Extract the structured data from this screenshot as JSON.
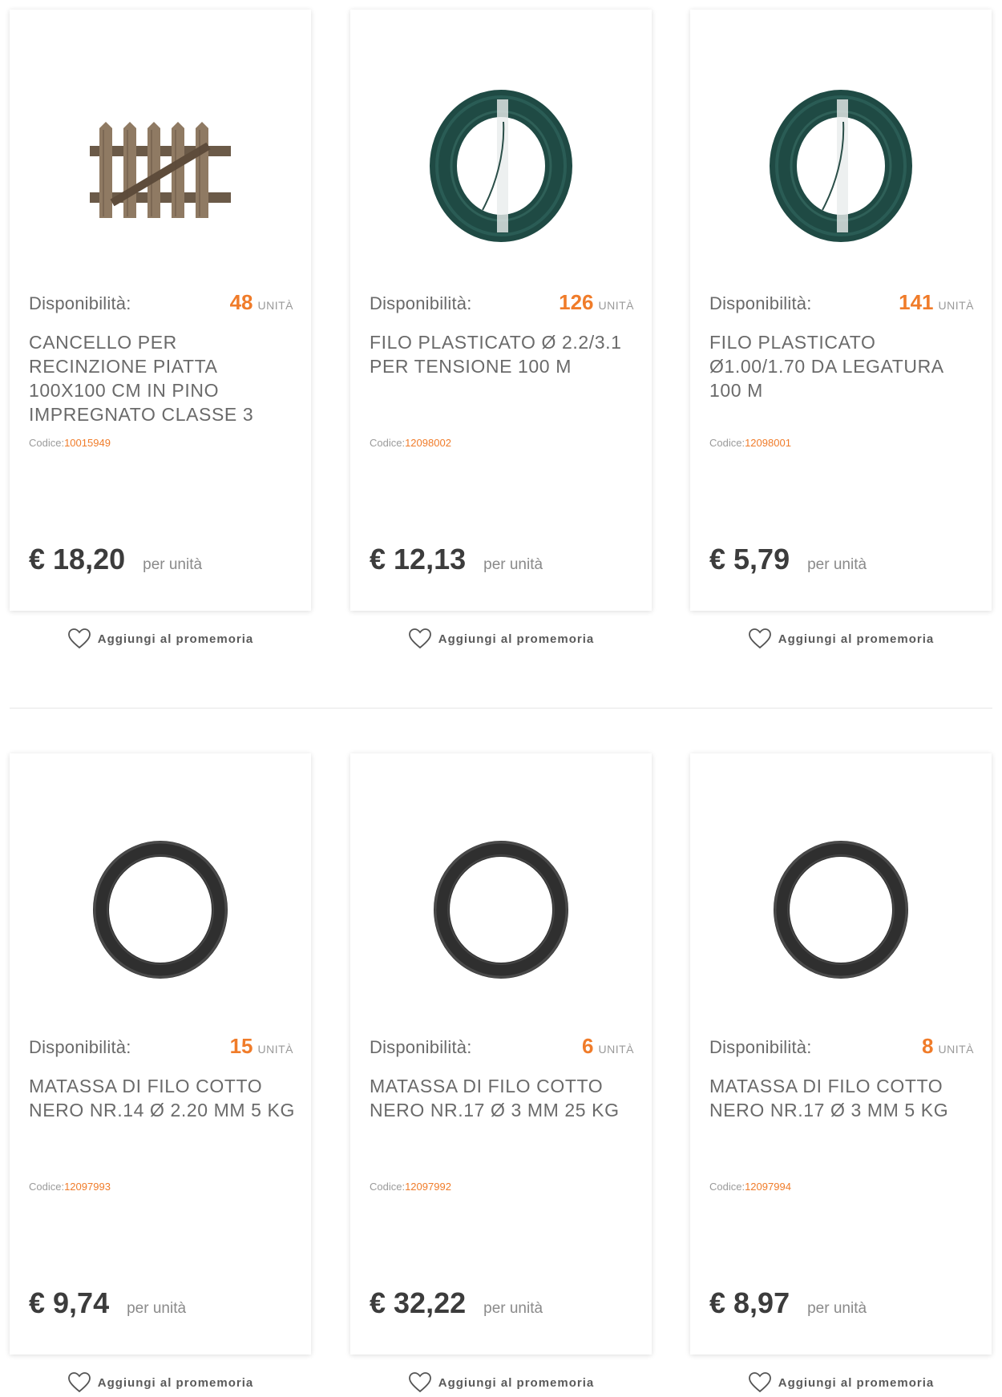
{
  "products": [
    {
      "image": "wooden-gate-image",
      "availability_label": "Disponibilità:",
      "quantity": "48",
      "unit": "UNITÀ",
      "title": "CANCELLO PER RECINZIONE PIATTA 100X100 CM IN PINO IMPREGNATO CLASSE 3",
      "code_label": "Codice:",
      "code": "10015949",
      "price": "€ 18,20",
      "per_unit": "per unità",
      "reminder_label": "Aggiungi al promemoria"
    },
    {
      "image": "green-wire-coil-image",
      "availability_label": "Disponibilità:",
      "quantity": "126",
      "unit": "UNITÀ",
      "title": "FILO PLASTICATO Ø 2.2/3.1 PER TENSIONE 100 M",
      "code_label": "Codice:",
      "code": "12098002",
      "price": "€ 12,13",
      "per_unit": "per unità",
      "reminder_label": "Aggiungi al promemoria"
    },
    {
      "image": "green-wire-coil-image",
      "availability_label": "Disponibilità:",
      "quantity": "141",
      "unit": "UNITÀ",
      "title": "FILO PLASTICATO Ø1.00/1.70 DA LEGATURA 100 M",
      "code_label": "Codice:",
      "code": "12098001",
      "price": "€ 5,79",
      "per_unit": "per unità",
      "reminder_label": "Aggiungi al promemoria"
    },
    {
      "image": "black-wire-coil-image",
      "availability_label": "Disponibilità:",
      "quantity": "15",
      "unit": "UNITÀ",
      "title": "MATASSA DI FILO COTTO NERO NR.14 Ø 2.20 MM 5 KG",
      "code_label": "Codice:",
      "code": "12097993",
      "price": "€ 9,74",
      "per_unit": "per unità",
      "reminder_label": "Aggiungi al promemoria"
    },
    {
      "image": "black-wire-coil-image",
      "availability_label": "Disponibilità:",
      "quantity": "6",
      "unit": "UNITÀ",
      "title": "MATASSA DI FILO COTTO NERO NR.17 Ø 3 MM 25 KG",
      "code_label": "Codice:",
      "code": "12097992",
      "price": "€ 32,22",
      "per_unit": "per unità",
      "reminder_label": "Aggiungi al promemoria"
    },
    {
      "image": "black-wire-coil-image",
      "availability_label": "Disponibilità:",
      "quantity": "8",
      "unit": "UNITÀ",
      "title": "MATASSA DI FILO COTTO NERO NR.17 Ø 3 MM 5 KG",
      "code_label": "Codice:",
      "code": "12097994",
      "price": "€ 8,97",
      "per_unit": "per unità",
      "reminder_label": "Aggiungi al promemoria"
    }
  ],
  "colors": {
    "accent": "#f07c2a",
    "text": "#6a6a6a",
    "price": "#3c3c3c"
  }
}
